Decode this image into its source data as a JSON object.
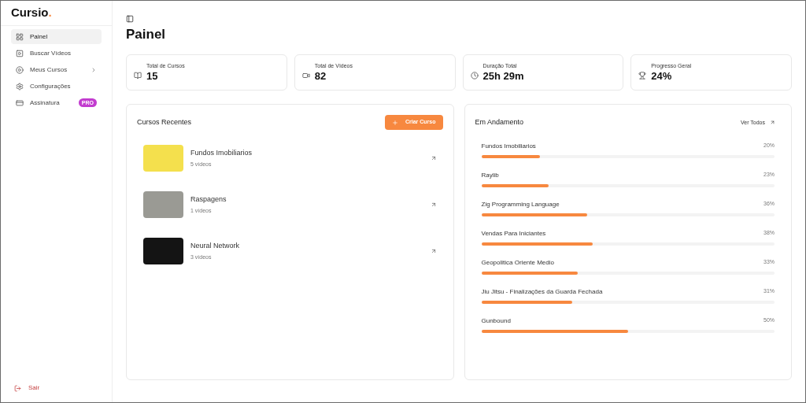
{
  "logo": {
    "name": "Cursio",
    "mark": "."
  },
  "sidebar": {
    "items": [
      {
        "label": "Painel",
        "selected": true,
        "expandable": false
      },
      {
        "label": "Buscar Vídeos",
        "selected": false,
        "expandable": false
      },
      {
        "label": "Meus Cursos",
        "selected": false,
        "expandable": true
      },
      {
        "label": "Configurações",
        "selected": false,
        "expandable": false
      },
      {
        "label": "Assinatura",
        "selected": false,
        "expandable": false,
        "badge": "PRO"
      }
    ],
    "logout": "Sair"
  },
  "page": {
    "title": "Painel"
  },
  "stats": [
    {
      "label": "Total de Cursos",
      "value": "15"
    },
    {
      "label": "Total de Vídeos",
      "value": "82"
    },
    {
      "label": "Duração Total",
      "value": "25h 29m"
    },
    {
      "label": "Progresso Geral",
      "value": "24%"
    }
  ],
  "recent": {
    "title": "Cursos Recentes",
    "button": "Criar Curso",
    "courses": [
      {
        "name": "Fundos Imobiliarios",
        "count": "5 vídeos"
      },
      {
        "name": "Raspagens",
        "count": "1 vídeos"
      },
      {
        "name": "Neural Network",
        "count": "3 vídeos"
      }
    ]
  },
  "progress": {
    "title": "Em Andamento",
    "link": "Ver Todos",
    "items": [
      {
        "name": "Fundos Imobiliarios",
        "reading": "20%",
        "level": 0.2
      },
      {
        "name": "Raylib",
        "reading": "23%",
        "level": 0.23
      },
      {
        "name": "Zig Programming Language",
        "reading": "36%",
        "level": 0.36
      },
      {
        "name": "Vendas Para Iniciantes",
        "reading": "38%",
        "level": 0.38
      },
      {
        "name": "Geopolitica Oriente Medio",
        "reading": "33%",
        "level": 0.33
      },
      {
        "name": "Jiu Jitsu - Finalizações da Guarda Fechada",
        "reading": "31%",
        "level": 0.31
      },
      {
        "name": "Gunbound",
        "reading": "50%",
        "level": 0.5
      }
    ]
  }
}
